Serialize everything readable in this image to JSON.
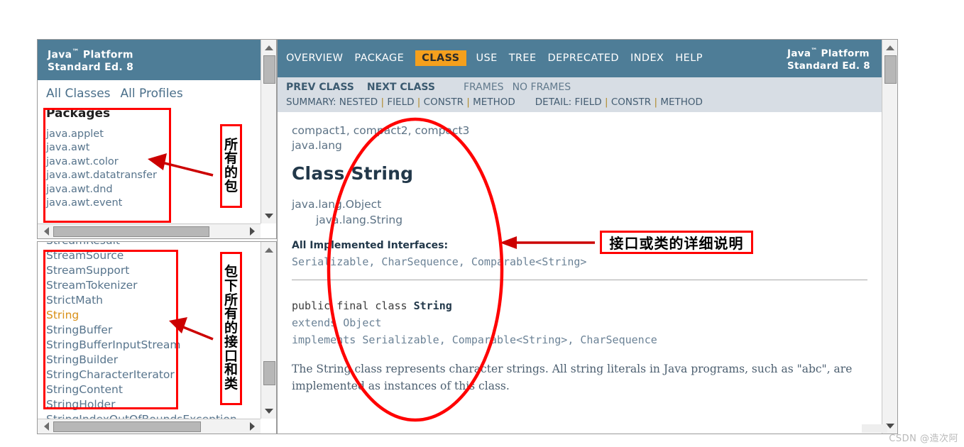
{
  "package_frame": {
    "header_title_line1": "Java",
    "header_tm": "™",
    "header_title_line1_rest": " Platform",
    "header_title_line2": "Standard Ed. 8",
    "links": [
      "All Classes",
      "All Profiles"
    ],
    "section_title": "Packages",
    "packages": [
      "java.applet",
      "java.awt",
      "java.awt.color",
      "java.awt.datatransfer",
      "java.awt.dnd",
      "java.awt.event"
    ]
  },
  "class_frame": {
    "clipped_top_item": "StreamResult",
    "classes": [
      {
        "name": "StreamSource",
        "selected": false
      },
      {
        "name": "StreamSupport",
        "selected": false
      },
      {
        "name": "StreamTokenizer",
        "selected": false
      },
      {
        "name": "StrictMath",
        "selected": false
      },
      {
        "name": "String",
        "selected": true
      },
      {
        "name": "StringBuffer",
        "selected": false
      },
      {
        "name": "StringBufferInputStream",
        "selected": false
      },
      {
        "name": "StringBuilder",
        "selected": false
      },
      {
        "name": "StringCharacterIterator",
        "selected": false
      },
      {
        "name": "StringContent",
        "selected": false
      },
      {
        "name": "StringHolder",
        "selected": false
      }
    ],
    "clipped_bottom_item": "StringIndexOutOfBoundsException"
  },
  "doc_frame": {
    "topnav": {
      "items": [
        {
          "label": "OVERVIEW",
          "active": false
        },
        {
          "label": "PACKAGE",
          "active": false
        },
        {
          "label": "CLASS",
          "active": true
        },
        {
          "label": "USE",
          "active": false
        },
        {
          "label": "TREE",
          "active": false
        },
        {
          "label": "DEPRECATED",
          "active": false
        },
        {
          "label": "INDEX",
          "active": false
        },
        {
          "label": "HELP",
          "active": false
        }
      ],
      "brand_line1": "Java",
      "brand_tm": "™",
      "brand_line1_rest": " Platform",
      "brand_line2": "Standard Ed. 8"
    },
    "subnav": {
      "prev_class": "PREV CLASS",
      "next_class": "NEXT CLASS",
      "frames": "FRAMES",
      "no_frames": "NO FRAMES",
      "summary_label": "SUMMARY:",
      "summary_items": [
        "NESTED",
        "FIELD",
        "CONSTR",
        "METHOD"
      ],
      "detail_label": "DETAIL:",
      "detail_items": [
        "FIELD",
        "CONSTR",
        "METHOD"
      ]
    },
    "profiles": "compact1, compact2, compact3",
    "package_name": "java.lang",
    "class_heading": "Class String",
    "tree_parent": "java.lang.Object",
    "tree_child": "java.lang.String",
    "implemented_heading": "All Implemented Interfaces:",
    "implemented_list": "Serializable, CharSequence, Comparable<String>",
    "decl_line1_kw": "public final class ",
    "decl_line1_name": "String",
    "decl_line2": "extends Object",
    "decl_line3": "implements Serializable, Comparable<String>, CharSequence",
    "description": "The String class represents character strings. All string literals in Java programs, such as \"abc\", are implemented as instances of this class."
  },
  "annotations": {
    "label_all_packages": "所有的包",
    "label_all_packages_chars": [
      "所",
      "有",
      "的",
      "包"
    ],
    "label_all_types": "包下所有的接口和类",
    "label_all_types_chars": [
      "包",
      "下",
      "所",
      "有",
      "的",
      "接",
      "口",
      "和",
      "类"
    ],
    "label_class_detail": "接口或类的详细说明",
    "accent_color": "#ff0000"
  },
  "watermark": {
    "text": "CSDN @造次阿"
  }
}
